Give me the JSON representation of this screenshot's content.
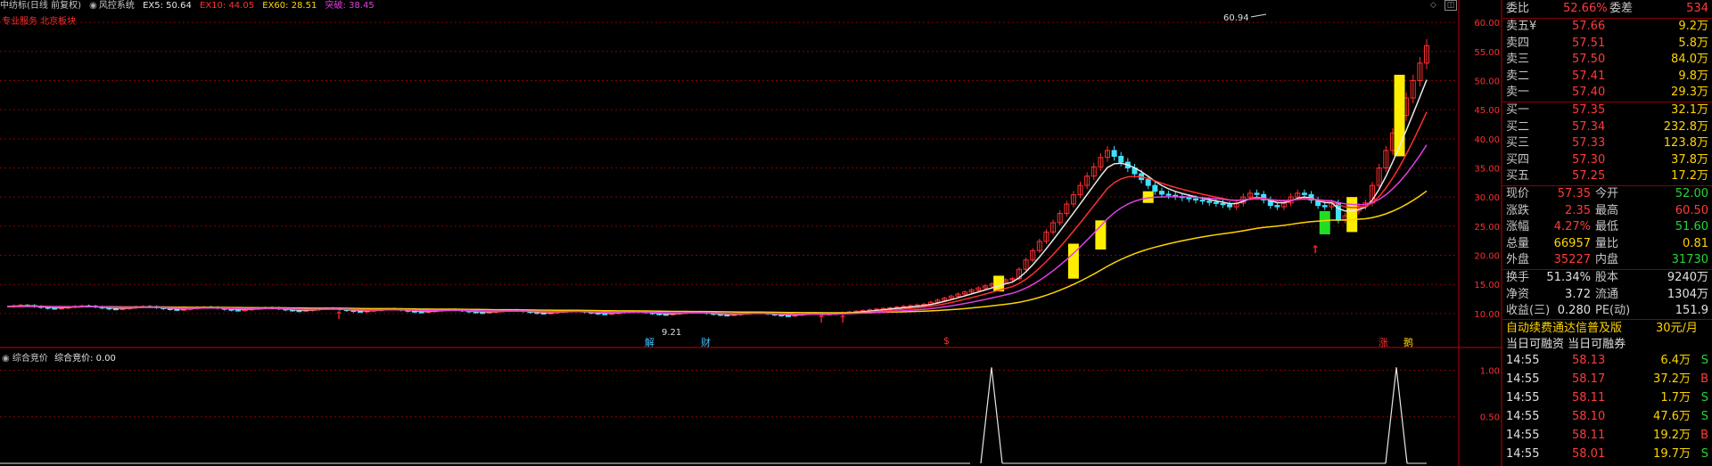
{
  "header": {
    "stock": "中纺标(日线 前复权)",
    "system_icon": "circle-dot-icon",
    "system": "风控系统",
    "ma_items": [
      {
        "label": "EX5: 50.64",
        "color": "#e8e8e8"
      },
      {
        "label": "EX10: 44.05",
        "color": "#ff3030"
      },
      {
        "label": "EX60: 28.51",
        "color": "#ffd400"
      },
      {
        "label": "突破: 38.45",
        "color": "#e040e0"
      }
    ],
    "subtitle": "专业服务 北京板块",
    "top_right_icons": [
      "diamond-icon",
      "expand-icon"
    ]
  },
  "main_axis": {
    "ticks": [
      "60.00",
      "55.00",
      "50.00",
      "45.00",
      "40.00",
      "35.00",
      "30.00",
      "25.00",
      "20.00",
      "15.00",
      "10.00"
    ],
    "tick_values": [
      60,
      55,
      50,
      45,
      40,
      35,
      30,
      25,
      20,
      15,
      10
    ]
  },
  "annotations": {
    "high_label": "60.94",
    "low_label": "9.21",
    "markers": [
      {
        "text": "解",
        "color": "#40c0ff"
      },
      {
        "text": "财",
        "color": "#40c0ff"
      },
      {
        "text": "$",
        "color": "#ff3030"
      },
      {
        "text": "涨",
        "color": "#ff3030"
      },
      {
        "text": "鹅",
        "color": "#ffd400"
      }
    ]
  },
  "indicator": {
    "title": "综合竞价",
    "value_label": "综合竞价: 0.00",
    "ticks": [
      "1.00",
      "0.50"
    ]
  },
  "quote": {
    "wei_bi_label": "委比",
    "wei_bi_value": "52.66%",
    "wei_cha_label": "委差",
    "wei_cha_value": "534",
    "asks": [
      {
        "label": "卖五¥",
        "price": "57.66",
        "vol": "9.2万"
      },
      {
        "label": "卖四",
        "price": "57.51",
        "vol": "5.8万"
      },
      {
        "label": "卖三",
        "price": "57.50",
        "vol": "84.0万"
      },
      {
        "label": "卖二",
        "price": "57.41",
        "vol": "9.8万"
      },
      {
        "label": "卖一",
        "price": "57.40",
        "vol": "29.3万"
      }
    ],
    "bids": [
      {
        "label": "买一",
        "price": "57.35",
        "vol": "32.1万"
      },
      {
        "label": "买二",
        "price": "57.34",
        "vol": "232.8万"
      },
      {
        "label": "买三",
        "price": "57.33",
        "vol": "123.8万"
      },
      {
        "label": "买四",
        "price": "57.30",
        "vol": "37.8万"
      },
      {
        "label": "买五",
        "price": "57.25",
        "vol": "17.2万"
      }
    ],
    "stats1": [
      {
        "l1": "现价",
        "v1": "57.35",
        "c1": "red",
        "l2": "今开",
        "v2": "52.00",
        "c2": "grn"
      },
      {
        "l1": "涨跌",
        "v1": "2.35",
        "c1": "red",
        "l2": "最高",
        "v2": "60.50",
        "c2": "red"
      },
      {
        "l1": "涨幅",
        "v1": "4.27%",
        "c1": "red",
        "l2": "最低",
        "v2": "51.60",
        "c2": "grn"
      },
      {
        "l1": "总量",
        "v1": "66957",
        "c1": "yel",
        "l2": "量比",
        "v2": "0.81",
        "c2": "yel"
      },
      {
        "l1": "外盘",
        "v1": "35227",
        "c1": "red",
        "l2": "内盘",
        "v2": "31730",
        "c2": "grn"
      }
    ],
    "stats2": [
      {
        "l1": "换手",
        "v1": "51.34%",
        "c1": "wht",
        "l2": "股本",
        "v2": "9240万",
        "c2": "wht"
      },
      {
        "l1": "净资",
        "v1": "3.72",
        "c1": "wht",
        "l2": "流通",
        "v2": "1304万",
        "c2": "wht"
      },
      {
        "l1": "收益(三)",
        "v1": "0.280",
        "c1": "wht",
        "l2": "PE(动)",
        "v2": "151.9",
        "c2": "wht"
      }
    ],
    "ad_text": "自动续费通达信普及版",
    "ad_price": "30元/月",
    "margin_label": "当日可融资 当日可融券",
    "ticks": [
      {
        "time": "14:55",
        "price": "58.13",
        "vol": "6.4万",
        "side": "S"
      },
      {
        "time": "14:55",
        "price": "58.17",
        "vol": "37.2万",
        "side": "B"
      },
      {
        "time": "14:55",
        "price": "58.11",
        "vol": "1.7万",
        "side": "S"
      },
      {
        "time": "14:55",
        "price": "58.10",
        "vol": "47.6万",
        "side": "S"
      },
      {
        "time": "14:55",
        "price": "58.11",
        "vol": "19.2万",
        "side": "B"
      },
      {
        "time": "14:55",
        "price": "58.01",
        "vol": "19.7万",
        "side": "S"
      }
    ]
  },
  "colors": {
    "up": "#ff3030",
    "down": "#40e0ff",
    "grid": "#8b0000",
    "ex5": "#e8e8e8",
    "ex10": "#ff3030",
    "ex60": "#ffd400",
    "breakout": "#e040e0",
    "highlight": "#ffee00",
    "green_bar": "#22dd22"
  }
}
